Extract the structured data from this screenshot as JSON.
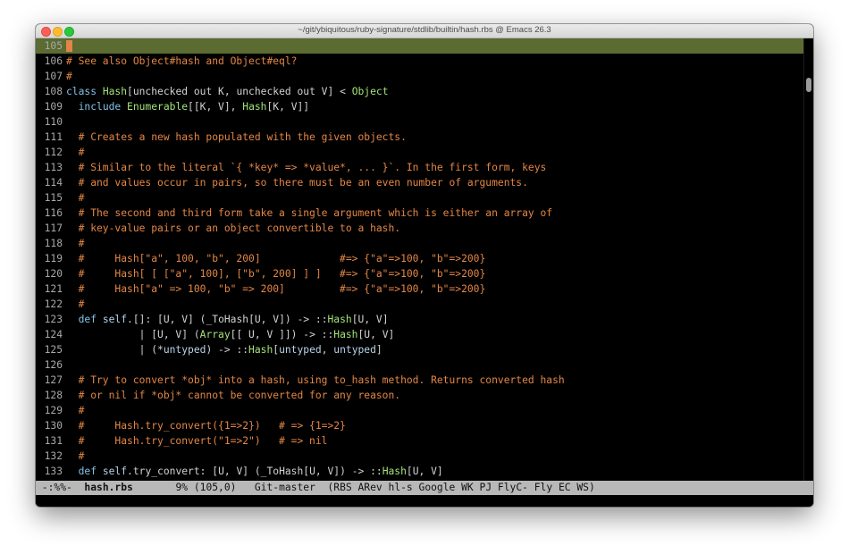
{
  "window": {
    "title": "~/git/ybiquitous/ruby-signature/stdlib/builtin/hash.rbs @ Emacs 26.3"
  },
  "editor": {
    "current_line": "105",
    "lines": [
      {
        "n": "105",
        "current": true,
        "parts": [
          [
            "c",
            "#",
            "cursor"
          ]
        ]
      },
      {
        "n": "106",
        "parts": [
          [
            "c",
            "# See also Object#hash and Object#eql?"
          ]
        ]
      },
      {
        "n": "107",
        "parts": [
          [
            "c",
            "#"
          ]
        ]
      },
      {
        "n": "108",
        "parts": [
          [
            "kw",
            "class "
          ],
          [
            "ty",
            "Hash"
          ],
          [
            "pl",
            "[unchecked out K, unchecked out V] < "
          ],
          [
            "ty",
            "Object"
          ]
        ]
      },
      {
        "n": "109",
        "parts": [
          [
            "pl",
            "  "
          ],
          [
            "kw",
            "include "
          ],
          [
            "ty",
            "Enumerable"
          ],
          [
            "pl",
            "[[K, V], "
          ],
          [
            "ty",
            "Hash"
          ],
          [
            "pl",
            "[K, V]]"
          ]
        ]
      },
      {
        "n": "110",
        "parts": []
      },
      {
        "n": "111",
        "parts": [
          [
            "c",
            "  # Creates a new hash populated with the given objects."
          ]
        ]
      },
      {
        "n": "112",
        "parts": [
          [
            "c",
            "  #"
          ]
        ]
      },
      {
        "n": "113",
        "parts": [
          [
            "c",
            "  # Similar to the literal `{ *key* => *value*, ... }`. In the first form, keys"
          ]
        ]
      },
      {
        "n": "114",
        "parts": [
          [
            "c",
            "  # and values occur in pairs, so there must be an even number of arguments."
          ]
        ]
      },
      {
        "n": "115",
        "parts": [
          [
            "c",
            "  #"
          ]
        ]
      },
      {
        "n": "116",
        "parts": [
          [
            "c",
            "  # The second and third form take a single argument which is either an array of"
          ]
        ]
      },
      {
        "n": "117",
        "parts": [
          [
            "c",
            "  # key-value pairs or an object convertible to a hash."
          ]
        ]
      },
      {
        "n": "118",
        "parts": [
          [
            "c",
            "  #"
          ]
        ]
      },
      {
        "n": "119",
        "parts": [
          [
            "c",
            "  #     Hash[\"a\", 100, \"b\", 200]             #=> {\"a\"=>100, \"b\"=>200}"
          ]
        ]
      },
      {
        "n": "120",
        "parts": [
          [
            "c",
            "  #     Hash[ [ [\"a\", 100], [\"b\", 200] ] ]   #=> {\"a\"=>100, \"b\"=>200}"
          ]
        ]
      },
      {
        "n": "121",
        "parts": [
          [
            "c",
            "  #     Hash[\"a\" => 100, \"b\" => 200]         #=> {\"a\"=>100, \"b\"=>200}"
          ]
        ]
      },
      {
        "n": "122",
        "parts": [
          [
            "c",
            "  #"
          ]
        ]
      },
      {
        "n": "123",
        "parts": [
          [
            "pl",
            "  "
          ],
          [
            "kw",
            "def "
          ],
          [
            "pa",
            "self"
          ],
          [
            "pl",
            ".[]: [U, V] (_ToHash[U, V]) -> ::"
          ],
          [
            "ty",
            "Hash"
          ],
          [
            "pl",
            "[U, V]"
          ]
        ]
      },
      {
        "n": "124",
        "parts": [
          [
            "pl",
            "            | [U, V] ("
          ],
          [
            "ty",
            "Array"
          ],
          [
            "pl",
            "[[ U, V ]]) -> ::"
          ],
          [
            "ty",
            "Hash"
          ],
          [
            "pl",
            "[U, V]"
          ]
        ]
      },
      {
        "n": "125",
        "parts": [
          [
            "pl",
            "            | (*"
          ],
          [
            "pa",
            "untyped"
          ],
          [
            "pl",
            ") -> ::"
          ],
          [
            "ty",
            "Hash"
          ],
          [
            "pl",
            "["
          ],
          [
            "pa",
            "untyped"
          ],
          [
            "pl",
            ", "
          ],
          [
            "pa",
            "untyped"
          ],
          [
            "pl",
            "]"
          ]
        ]
      },
      {
        "n": "126",
        "parts": []
      },
      {
        "n": "127",
        "parts": [
          [
            "c",
            "  # Try to convert *obj* into a hash, using to_hash method. Returns converted hash"
          ]
        ]
      },
      {
        "n": "128",
        "parts": [
          [
            "c",
            "  # or nil if *obj* cannot be converted for any reason."
          ]
        ]
      },
      {
        "n": "129",
        "parts": [
          [
            "c",
            "  #"
          ]
        ]
      },
      {
        "n": "130",
        "parts": [
          [
            "c",
            "  #     Hash.try_convert({1=>2})   # => {1=>2}"
          ]
        ]
      },
      {
        "n": "131",
        "parts": [
          [
            "c",
            "  #     Hash.try_convert(\"1=>2\")   # => nil"
          ]
        ]
      },
      {
        "n": "132",
        "parts": [
          [
            "c",
            "  #"
          ]
        ]
      },
      {
        "n": "133",
        "parts": [
          [
            "pl",
            "  "
          ],
          [
            "kw",
            "def "
          ],
          [
            "pa",
            "self"
          ],
          [
            "pl",
            ".try_convert: [U, V] (_ToHash[U, V]) -> ::"
          ],
          [
            "ty",
            "Hash"
          ],
          [
            "pl",
            "[U, V]"
          ]
        ]
      }
    ]
  },
  "modeline": {
    "status": " -:%%-",
    "buffer": "hash.rbs",
    "position": "9% (105,0)",
    "vc": "Git-master",
    "modes": "(RBS ARev hl-s Google WK PJ FlyC- Fly EC WS)"
  }
}
